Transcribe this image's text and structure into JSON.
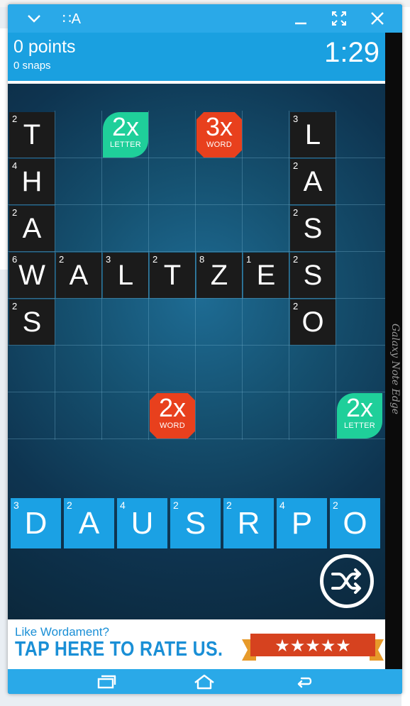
{
  "emulator": {
    "device_label": "Galaxy Note Edge",
    "titlebar_icons": [
      "chevron-down-icon",
      "keyboard-layout-icon",
      "minimize-icon",
      "fullscreen-icon",
      "close-icon"
    ],
    "titlebar_text": "∷A",
    "accent": "#2aa9e8"
  },
  "scorebar": {
    "points": "0 points",
    "snaps": "0 snaps",
    "timer": "1:29"
  },
  "board": {
    "tiles": [
      {
        "letter": "T",
        "value": "2"
      },
      {
        "letter": "H",
        "value": "4"
      },
      {
        "letter": "A",
        "value": "2"
      },
      {
        "letter": "W",
        "value": "6"
      },
      {
        "letter": "A",
        "value": "2"
      },
      {
        "letter": "L",
        "value": "3"
      },
      {
        "letter": "T",
        "value": "2"
      },
      {
        "letter": "Z",
        "value": "8"
      },
      {
        "letter": "E",
        "value": "1"
      },
      {
        "letter": "S",
        "value": "2"
      },
      {
        "letter": "S",
        "value": "2"
      },
      {
        "letter": "L",
        "value": "3"
      },
      {
        "letter": "A",
        "value": "2"
      },
      {
        "letter": "S",
        "value": "2"
      },
      {
        "letter": "O",
        "value": "2"
      }
    ],
    "bonuses": [
      {
        "mult": "2x",
        "kind": "LETTER",
        "color": "#1fcf9a"
      },
      {
        "mult": "3x",
        "kind": "WORD",
        "color": "#e8401d"
      },
      {
        "mult": "2x",
        "kind": "WORD",
        "color": "#e8401d"
      },
      {
        "mult": "2x",
        "kind": "LETTER",
        "color": "#1fcf9a"
      }
    ]
  },
  "rack": {
    "tiles": [
      {
        "letter": "D",
        "value": "3"
      },
      {
        "letter": "A",
        "value": "2"
      },
      {
        "letter": "U",
        "value": "4"
      },
      {
        "letter": "S",
        "value": "2"
      },
      {
        "letter": "R",
        "value": "2"
      },
      {
        "letter": "P",
        "value": "4"
      },
      {
        "letter": "O",
        "value": "2"
      }
    ],
    "shuffle_icon": "shuffle-icon"
  },
  "banner": {
    "line1": "Like Wordament?",
    "line2": "TAP HERE TO RATE US.",
    "stars": "★★★★★"
  },
  "navbar": {
    "icons": [
      "recent-apps-icon",
      "home-icon",
      "back-icon"
    ]
  }
}
